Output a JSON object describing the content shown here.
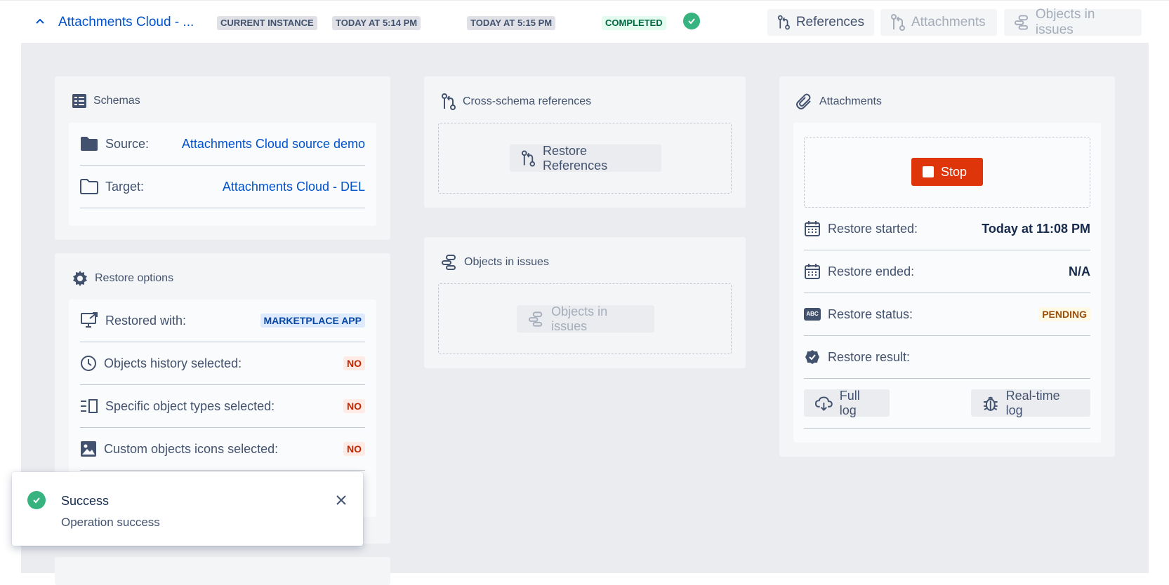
{
  "header": {
    "title": "Attachments Cloud - ...",
    "badges": {
      "instance": "CURRENT INSTANCE",
      "started": "TODAY AT 5:14 PM",
      "ended": "TODAY AT 5:15 PM",
      "status": "COMPLETED"
    },
    "tabs": {
      "references": "References",
      "attachments": "Attachments",
      "objects": "Objects in issues"
    }
  },
  "schemas": {
    "title": "Schemas",
    "source_label": "Source:",
    "source_value": "Attachments Cloud source demo",
    "target_label": "Target:",
    "target_value": "Attachments Cloud - DEL"
  },
  "restore_options": {
    "title": "Restore options",
    "rows": [
      {
        "label": "Restored with:",
        "value": "MARKETPLACE APP"
      },
      {
        "label": "Objects history selected:",
        "value": "NO"
      },
      {
        "label": "Specific object types selected:",
        "value": "NO"
      },
      {
        "label": "Custom objects icons selected:",
        "value": "NO"
      }
    ]
  },
  "cross_schema": {
    "title": "Cross-schema references",
    "button": "Restore References"
  },
  "objects_in_issues": {
    "title": "Objects in issues",
    "button": "Objects in issues"
  },
  "attachments": {
    "title": "Attachments",
    "stop_button": "Stop",
    "started_label": "Restore started:",
    "started_value": "Today at 11:08 PM",
    "ended_label": "Restore ended:",
    "ended_value": "N/A",
    "status_label": "Restore status:",
    "status_value": "PENDING",
    "result_label": "Restore result:",
    "full_log": "Full log",
    "realtime_log": "Real-time log"
  },
  "toast": {
    "title": "Success",
    "message": "Operation success"
  },
  "colors": {
    "primary": "#0052cc",
    "success": "#36b37e",
    "danger": "#de350b",
    "background": "#ebecf0"
  }
}
